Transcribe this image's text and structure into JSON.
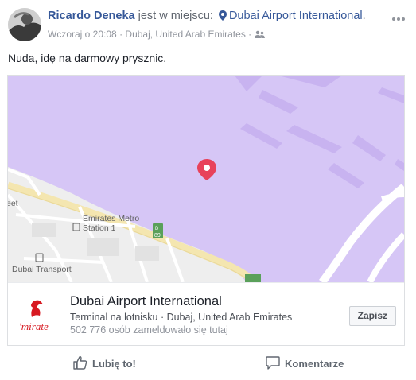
{
  "post": {
    "author": "Ricardo Deneka",
    "verb": "jest w miejscu:",
    "place": "Dubai Airport International",
    "place_suffix": ".",
    "time": "Wczoraj o 20:08",
    "location": "Dubaj, United Arab Emirates",
    "separator": "·",
    "text": "Nuda, idę na darmowy prysznic."
  },
  "map": {
    "labels": {
      "street": "eet",
      "metro": "Emirates Metro",
      "metro_station": "Station 1",
      "transport": "Dubai Transport",
      "road_sign_top": "D",
      "road_sign_num": "89"
    },
    "colors": {
      "water": "#d5c4f7",
      "runway": "#c9b5f1",
      "land": "#eeeeee",
      "road": "#f6e9b5",
      "pin": "#e8425b"
    }
  },
  "card": {
    "title": "Dubai Airport International",
    "category": "Terminal na lotnisku · Dubaj, United Arab Emirates",
    "count": "502 776 osób zameldowało się tutaj",
    "save_label": "Zapisz",
    "logo_text": "'mirate"
  },
  "actions": {
    "like": "Lubię to!",
    "comment": "Komentarze"
  },
  "icons": [
    "avatar",
    "pin-icon",
    "friends-icon",
    "more-icon",
    "map-pin-icon",
    "metro-icon",
    "bus-icon",
    "emirates-logo",
    "thumbs-up-icon",
    "comment-icon"
  ]
}
